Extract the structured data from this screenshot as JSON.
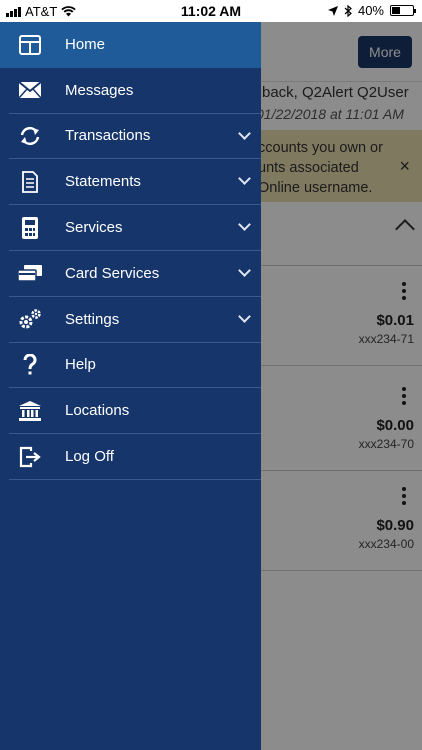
{
  "status_bar": {
    "carrier": "AT&T",
    "time": "11:02 AM",
    "battery": "40%",
    "battery_level": 0.4
  },
  "background": {
    "more_label": "More",
    "welcome": "back, Q2Alert Q2User",
    "last_login": "01/22/2018 at 11:01 AM",
    "alert_lines": [
      "ccounts you own or",
      "unts associated",
      "Online username."
    ],
    "alert_close": "×",
    "accounts": [
      {
        "amount": "$0.01",
        "number": "xxx234-71"
      },
      {
        "amount": "$0.00",
        "number": "xxx234-70"
      },
      {
        "amount": "$0.90",
        "number": "xxx234-00"
      }
    ]
  },
  "menu": {
    "items": [
      {
        "label": "Home",
        "icon": "home-icon",
        "active": true,
        "expandable": false
      },
      {
        "label": "Messages",
        "icon": "envelope-icon",
        "active": false,
        "expandable": false
      },
      {
        "label": "Transactions",
        "icon": "transfer-icon",
        "active": false,
        "expandable": true
      },
      {
        "label": "Statements",
        "icon": "document-icon",
        "active": false,
        "expandable": true
      },
      {
        "label": "Services",
        "icon": "calculator-icon",
        "active": false,
        "expandable": true
      },
      {
        "label": "Card Services",
        "icon": "credit-card-icon",
        "active": false,
        "expandable": true
      },
      {
        "label": "Settings",
        "icon": "gears-icon",
        "active": false,
        "expandable": true
      },
      {
        "label": "Help",
        "icon": "question-icon",
        "active": false,
        "expandable": false
      },
      {
        "label": "Locations",
        "icon": "bank-icon",
        "active": false,
        "expandable": false
      },
      {
        "label": "Log Off",
        "icon": "logout-icon",
        "active": false,
        "expandable": false
      }
    ]
  },
  "colors": {
    "drawer": "#16356b",
    "active_item": "#1f5b99",
    "more_button": "#1b3866",
    "alert_banner": "#e8dcae"
  }
}
